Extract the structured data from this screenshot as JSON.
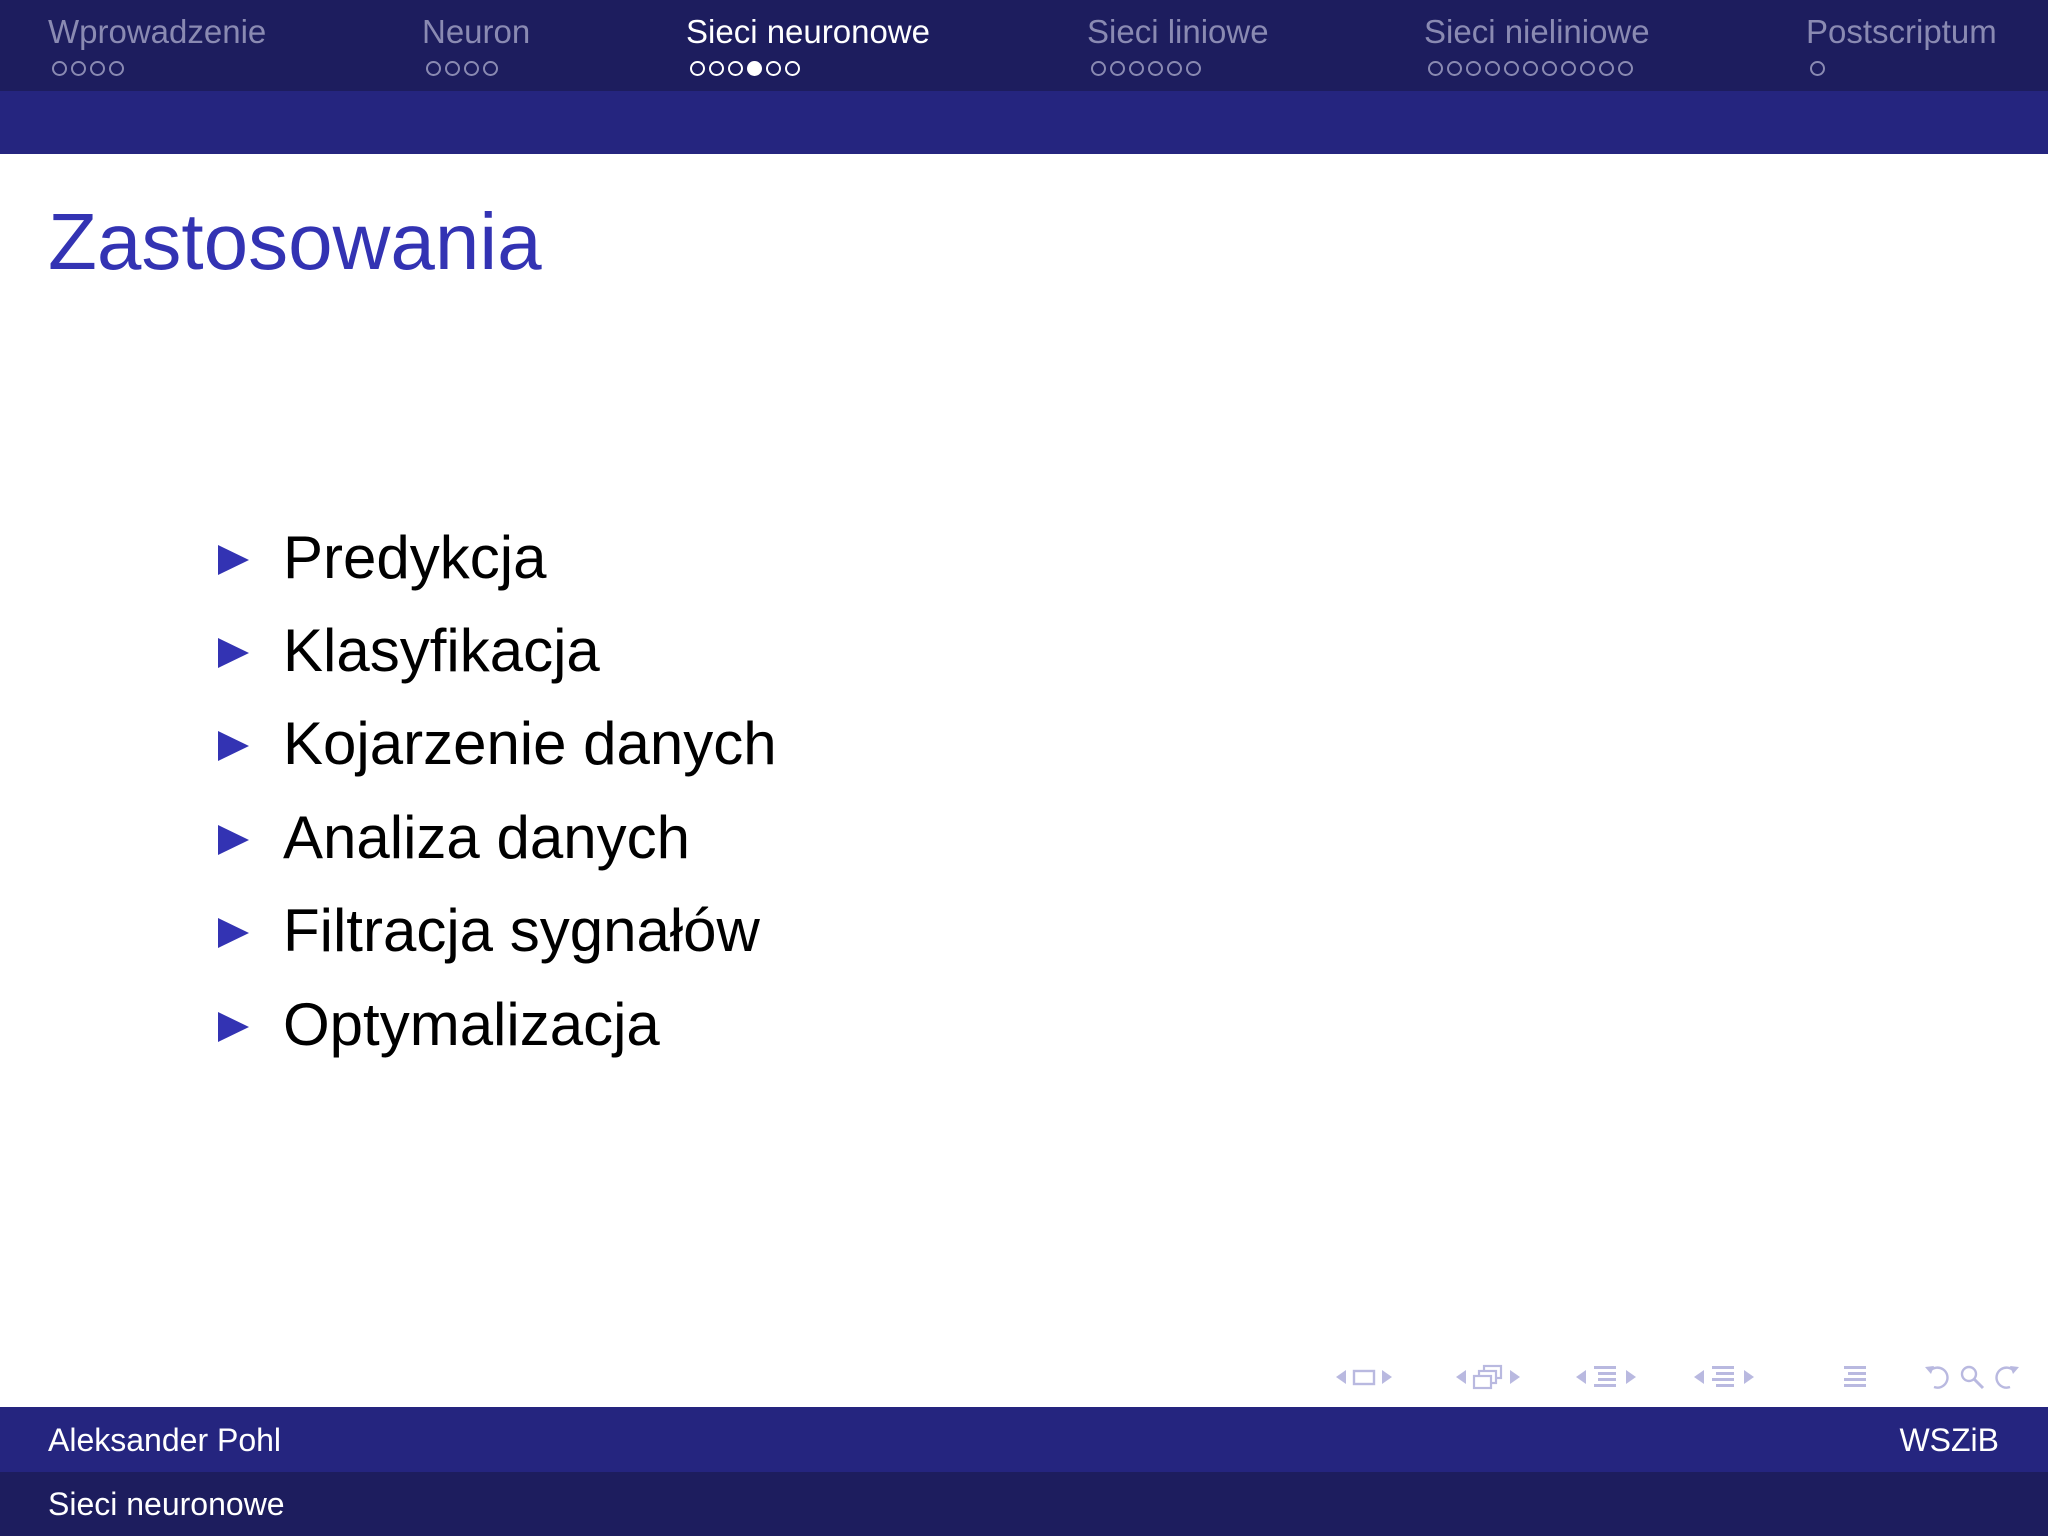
{
  "header": {
    "sections": [
      {
        "label": "Wprowadzenie",
        "dots": 4,
        "filled": -1,
        "active": false
      },
      {
        "label": "Neuron",
        "dots": 4,
        "filled": -1,
        "active": false
      },
      {
        "label": "Sieci neuronowe",
        "dots": 6,
        "filled": 3,
        "active": true
      },
      {
        "label": "Sieci liniowe",
        "dots": 6,
        "filled": -1,
        "active": false
      },
      {
        "label": "Sieci nieliniowe",
        "dots": 11,
        "filled": -1,
        "active": false
      },
      {
        "label": "Postscriptum",
        "dots": 1,
        "filled": -1,
        "active": false
      }
    ]
  },
  "frame": {
    "title": "Zastosowania",
    "items": [
      "Predykcja",
      "Klasyfikacja",
      "Kojarzenie danych",
      "Analiza danych",
      "Filtracja sygnałów",
      "Optymalizacja"
    ]
  },
  "footer": {
    "author": "Aleksander Pohl",
    "institute": "WSZiB",
    "short_title": "Sieci neuronowe"
  },
  "colors": {
    "nav_dark": "#1d1d5e",
    "nav_mid": "#25257f",
    "accent": "#3333b3"
  }
}
